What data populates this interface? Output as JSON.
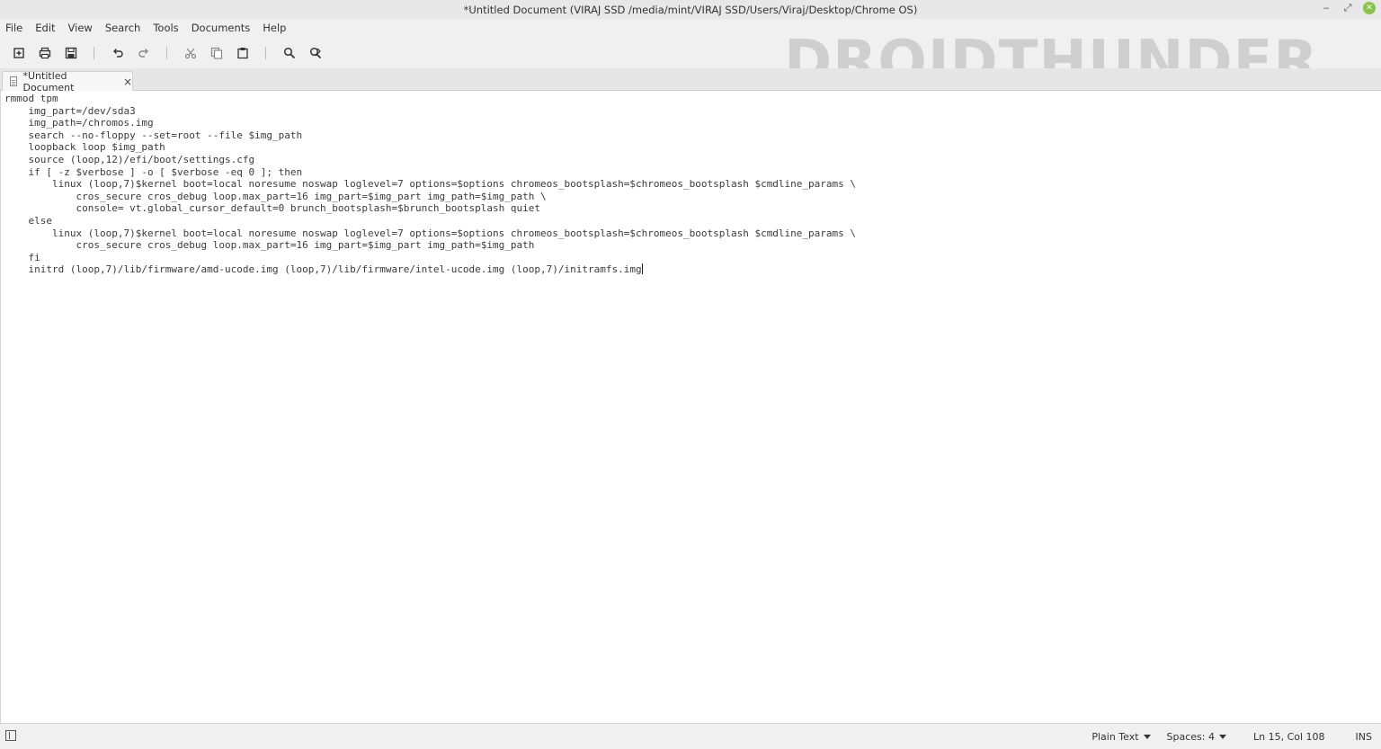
{
  "window": {
    "title": "*Untitled Document (VIRAJ SSD /media/mint/VIRAJ SSD/Users/Viraj/Desktop/Chrome OS)",
    "controls": [
      "minimize-icon",
      "maximize-icon",
      "close-icon"
    ]
  },
  "menu": {
    "items": [
      {
        "label": "File"
      },
      {
        "label": "Edit"
      },
      {
        "label": "View"
      },
      {
        "label": "Search"
      },
      {
        "label": "Tools"
      },
      {
        "label": "Documents"
      },
      {
        "label": "Help"
      }
    ]
  },
  "toolbar": {
    "icons": [
      "new-document-icon",
      "print-icon",
      "save-icon",
      "undo-icon",
      "redo-icon",
      "cut-icon",
      "copy-icon",
      "paste-icon",
      "find-icon",
      "find-replace-icon"
    ]
  },
  "watermark": {
    "text": "DROIDTHUNDER"
  },
  "tabs": [
    {
      "label": "*Untitled Document",
      "close": "×"
    }
  ],
  "editor": {
    "lines": [
      "rmmod tpm",
      "    img_part=/dev/sda3",
      "    img_path=/chromos.img",
      "    search --no-floppy --set=root --file $img_path",
      "    loopback loop $img_path",
      "    source (loop,12)/efi/boot/settings.cfg",
      "    if [ -z $verbose ] -o [ $verbose -eq 0 ]; then",
      "        linux (loop,7)$kernel boot=local noresume noswap loglevel=7 options=$options chromeos_bootsplash=$chromeos_bootsplash $cmdline_params \\",
      "            cros_secure cros_debug loop.max_part=16 img_part=$img_part img_path=$img_path \\",
      "            console= vt.global_cursor_default=0 brunch_bootsplash=$brunch_bootsplash quiet",
      "    else",
      "        linux (loop,7)$kernel boot=local noresume noswap loglevel=7 options=$options chromeos_bootsplash=$chromeos_bootsplash $cmdline_params \\",
      "            cros_secure cros_debug loop.max_part=16 img_part=$img_part img_path=$img_path",
      "    fi",
      "    initrd (loop,7)/lib/firmware/amd-ucode.img (loop,7)/lib/firmware/intel-ucode.img (loop,7)/initramfs.img"
    ]
  },
  "statusbar": {
    "language": "Plain Text",
    "spaces": "Spaces: 4",
    "position": "Ln 15, Col 108",
    "mode": "INS"
  }
}
